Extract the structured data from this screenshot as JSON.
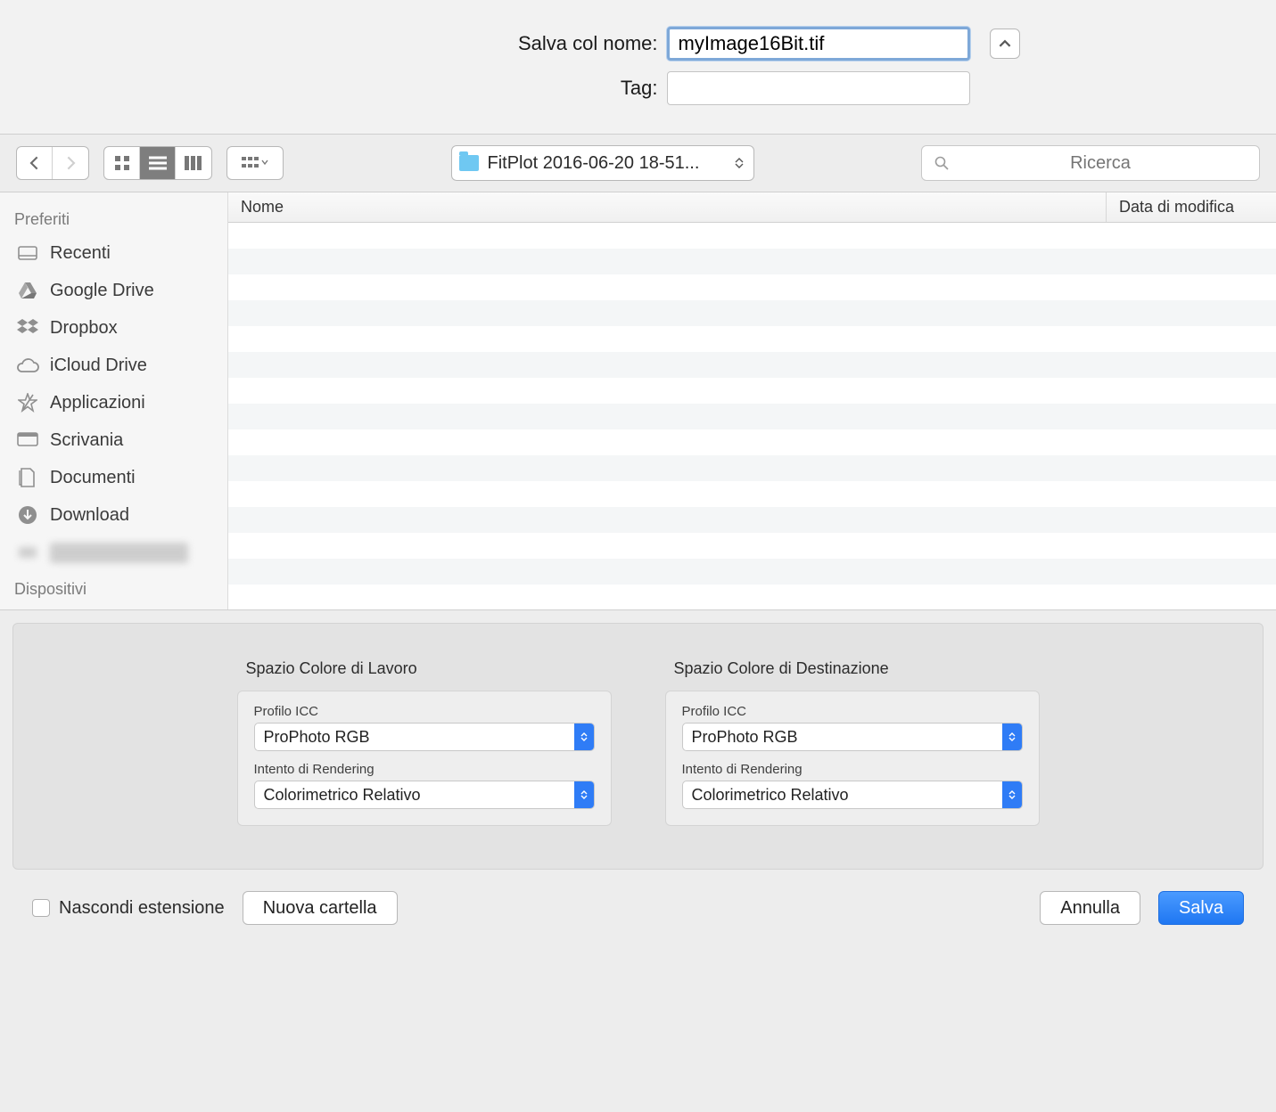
{
  "header": {
    "filename_label": "Salva col nome:",
    "filename_value": "myImage16Bit.tif",
    "tag_label": "Tag:",
    "tag_value": ""
  },
  "toolbar": {
    "folder_name": "FitPlot 2016-06-20 18-51...",
    "search_placeholder": "Ricerca"
  },
  "sidebar": {
    "section_favorites": "Preferiti",
    "section_devices": "Dispositivi",
    "items": [
      {
        "label": "Recenti",
        "icon": "recents"
      },
      {
        "label": "Google Drive",
        "icon": "gdrive"
      },
      {
        "label": "Dropbox",
        "icon": "dropbox"
      },
      {
        "label": "iCloud Drive",
        "icon": "icloud"
      },
      {
        "label": "Applicazioni",
        "icon": "apps"
      },
      {
        "label": "Scrivania",
        "icon": "desktop"
      },
      {
        "label": "Documenti",
        "icon": "documents"
      },
      {
        "label": "Download",
        "icon": "download"
      }
    ]
  },
  "columns": {
    "name": "Nome",
    "date": "Data di modifica"
  },
  "options": {
    "working": {
      "title": "Spazio Colore di Lavoro",
      "profile_label": "Profilo ICC",
      "profile_value": "ProPhoto RGB",
      "intent_label": "Intento di Rendering",
      "intent_value": "Colorimetrico Relativo"
    },
    "dest": {
      "title": "Spazio Colore di Destinazione",
      "profile_label": "Profilo ICC",
      "profile_value": "ProPhoto RGB",
      "intent_label": "Intento di Rendering",
      "intent_value": "Colorimetrico Relativo"
    }
  },
  "bottom": {
    "hide_ext": "Nascondi estensione",
    "new_folder": "Nuova cartella",
    "cancel": "Annulla",
    "save": "Salva"
  }
}
